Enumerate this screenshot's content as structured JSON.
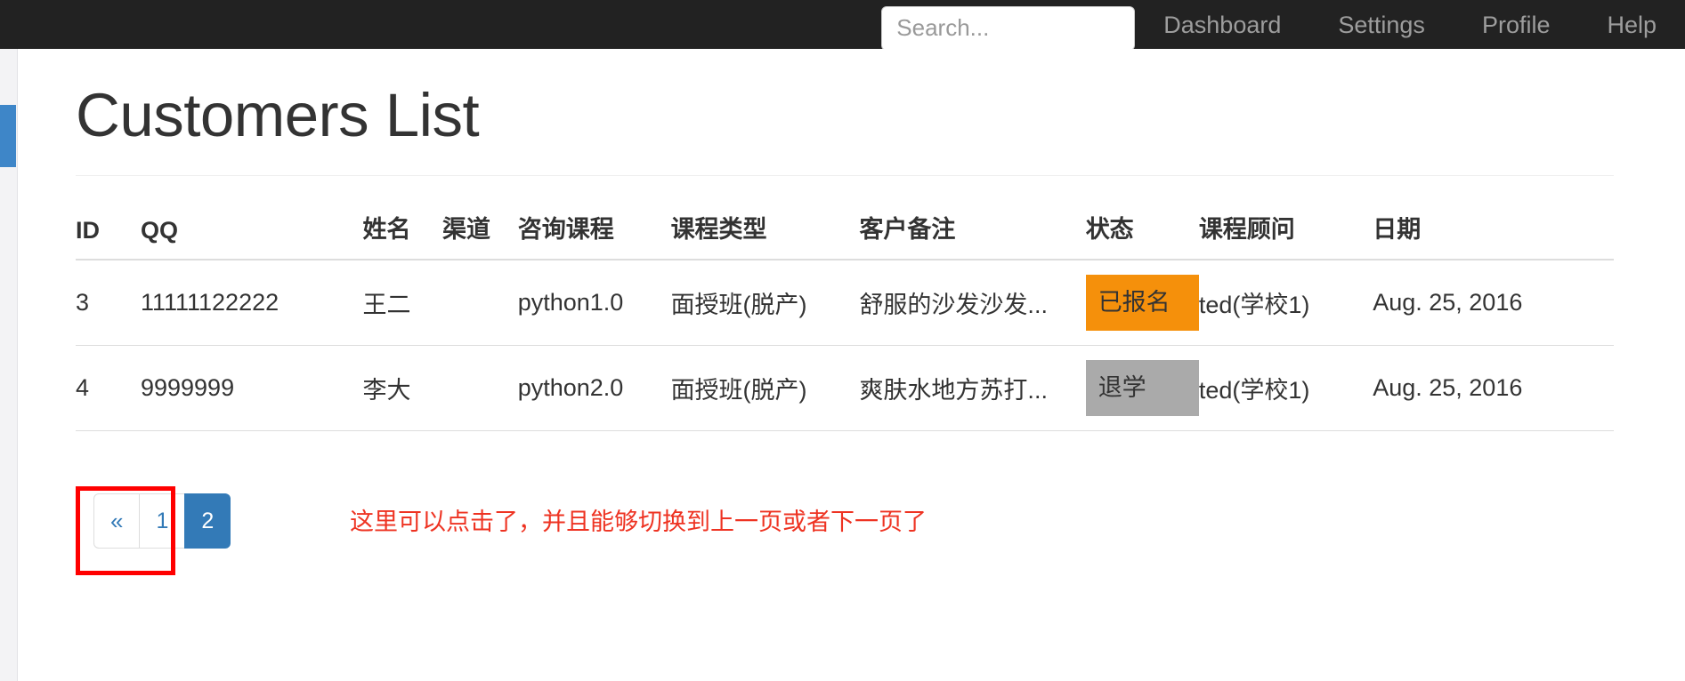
{
  "navbar": {
    "search": {
      "placeholder": "Search...",
      "value": ""
    },
    "links": [
      {
        "label": "Dashboard"
      },
      {
        "label": "Settings"
      },
      {
        "label": "Profile"
      },
      {
        "label": "Help"
      }
    ]
  },
  "main": {
    "title": "Customers List",
    "table": {
      "headers": [
        "ID",
        "QQ",
        "姓名",
        "渠道",
        "咨询课程",
        "课程类型",
        "客户备注",
        "状态",
        "课程顾问",
        "日期"
      ],
      "rows": [
        {
          "id": "3",
          "qq": "11111122222",
          "name": "王二",
          "channel": "",
          "consult_course": "python1.0",
          "course_type": "面授班(脱产)",
          "note": "舒服的沙发沙发...",
          "status": "已报名",
          "status_color": "#f5900b",
          "advisor": "ted(学校1)",
          "date": "Aug. 25, 2016"
        },
        {
          "id": "4",
          "qq": "9999999",
          "name": "李大",
          "channel": "",
          "consult_course": "python2.0",
          "course_type": "面授班(脱产)",
          "note": "爽肤水地方苏打...",
          "status": "退学",
          "status_color": "#aaaaaa",
          "advisor": "ted(学校1)",
          "date": "Aug. 25, 2016"
        }
      ]
    },
    "pagination": {
      "prev_label": "«",
      "pages": [
        {
          "label": "1",
          "active": false
        },
        {
          "label": "2",
          "active": true
        }
      ]
    },
    "annotation": {
      "text": "这里可以点击了，并且能够切换到上一页或者下一页了",
      "color": "#ee3322"
    }
  }
}
